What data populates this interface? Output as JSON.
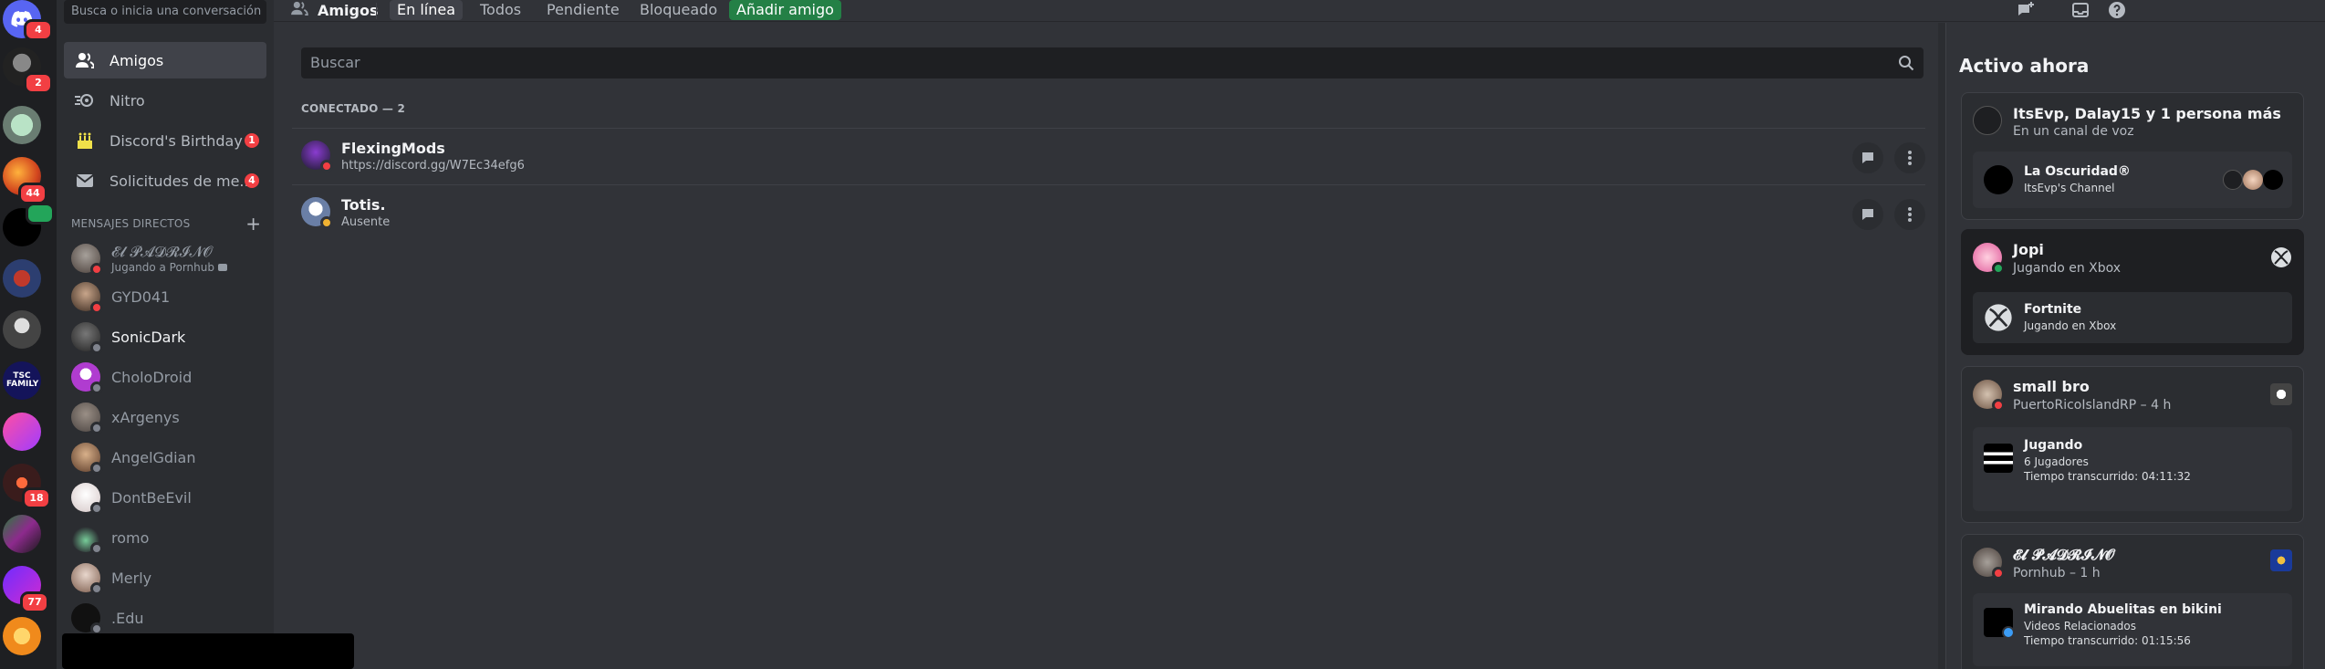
{
  "servers": [
    {
      "badge": "4",
      "kind": "home"
    },
    {
      "badge": "2"
    },
    {
      "badge": ""
    },
    {
      "badge": "44"
    },
    {
      "badge": "",
      "green": true
    },
    {
      "badge": ""
    },
    {
      "badge": ""
    },
    {
      "badge": "",
      "text": "TSC FAMILY"
    },
    {
      "badge": ""
    },
    {
      "badge": "18"
    },
    {
      "badge": ""
    },
    {
      "badge": "77"
    },
    {
      "badge": ""
    }
  ],
  "sidebar": {
    "search_placeholder": "Busca o inicia una conversación",
    "nav": [
      {
        "label": "Amigos",
        "badge": ""
      },
      {
        "label": "Nitro",
        "badge": ""
      },
      {
        "label": "Discord's Birthday",
        "badge": "1"
      },
      {
        "label": "Solicitudes de me...",
        "badge": "4"
      }
    ],
    "dm_header": "MENSAJES DIRECTOS",
    "dm_add": "+",
    "dms": [
      {
        "name": "𝓔𝓵 𝓟𝓐𝓓𝓡𝓘𝓝𝓞",
        "sub": "Jugando a Pornhub",
        "status": "dnd"
      },
      {
        "name": "GYD041",
        "sub": "",
        "status": "dnd"
      },
      {
        "name": "SonicDark",
        "sub": "",
        "status": "off"
      },
      {
        "name": "CholoDroid",
        "sub": "",
        "status": "off"
      },
      {
        "name": "xArgenys",
        "sub": "",
        "status": "off"
      },
      {
        "name": "AngelGdian",
        "sub": "",
        "status": "off"
      },
      {
        "name": "DontBeEvil",
        "sub": "",
        "status": "off"
      },
      {
        "name": "romo",
        "sub": "",
        "status": "off"
      },
      {
        "name": "Merly",
        "sub": "",
        "status": "off"
      },
      {
        "name": ".Edu",
        "sub": "",
        "status": "off"
      }
    ]
  },
  "topbar": {
    "title": "Amigos",
    "tabs": [
      "En línea",
      "Todos",
      "Pendiente",
      "Bloqueado"
    ],
    "add_friend": "Añadir amigo"
  },
  "main": {
    "search_placeholder": "Buscar",
    "section": "CONECTADO — 2",
    "friends": [
      {
        "name": "FlexingMods",
        "sub": "https://discord.gg/W7Ec34efg6",
        "status": "dnd"
      },
      {
        "name": "Totis.",
        "sub": "Ausente",
        "status": "idle"
      }
    ]
  },
  "active_now": {
    "title": "Activo ahora",
    "cards": [
      {
        "name": "ItsEvp, Dalay15 y 1 persona más",
        "sub": "En un canal de voz",
        "inner_title": "La Oscuridad®",
        "inner_sub": "ItsEvp's Channel"
      },
      {
        "name": "Jopi",
        "sub": "Jugando en Xbox",
        "inner_title": "Fortnite",
        "inner_sub": "Jugando en Xbox"
      },
      {
        "name": "small bro",
        "sub": "PuertoRicoIslandRP – 4 h",
        "inner_title": "Jugando",
        "inner_sub": "6 Jugadores",
        "inner_sub2": "Tiempo transcurrido: 04:11:32"
      },
      {
        "name": "𝓔𝓵 𝓟𝓐𝓓𝓡𝓘𝓝𝓞",
        "sub": "Pornhub – 1 h",
        "inner_title": "Mirando Abuelitas en bikini",
        "inner_sub": "Videos Relacionados",
        "inner_sub2": "Tiempo transcurrido: 01:15:56"
      }
    ]
  },
  "colors": {
    "accent": "#5865f2",
    "green": "#248046",
    "dnd": "#f23f43",
    "idle": "#f0b232"
  }
}
